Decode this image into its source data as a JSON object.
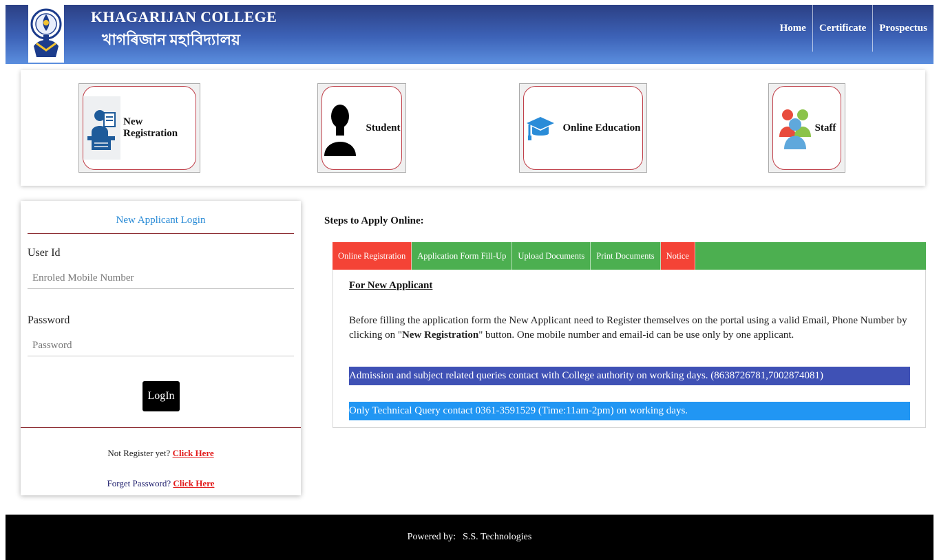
{
  "header": {
    "college_name_en": "KHAGARIJAN COLLEGE",
    "college_name_bn": "খাগৰিজান মহাবিদ্যালয়",
    "nav": [
      "Home",
      "Certificate",
      "Prospectus"
    ]
  },
  "tiles": [
    {
      "label": "New Registration",
      "icon": "registration-desk-icon"
    },
    {
      "label": "Student",
      "icon": "person-silhouette-icon"
    },
    {
      "label": "Online Education",
      "icon": "graduation-cap-icon"
    },
    {
      "label": "Staff",
      "icon": "group-people-icon"
    }
  ],
  "login": {
    "title": "New Applicant Login",
    "user_id_label": "User Id",
    "user_id_placeholder": "Enroled Mobile Number",
    "password_label": "Password",
    "password_placeholder": "Password",
    "button": "LogIn",
    "not_register_text": "Not Register yet? ",
    "not_register_link": "Click Here",
    "forget_text": "Forget Password? ",
    "forget_link": "Click Here"
  },
  "steps": {
    "title": "Steps to Apply Online:",
    "tabs": [
      "Online Registration",
      "Application Form Fill-Up",
      "Upload Documents",
      "Print Documents",
      "Notice"
    ],
    "heading": "For New Applicant",
    "para_before": "Before filling the application form the New Applicant need to Register themselves on the portal using a valid Email, Phone Number by clicking on \"",
    "para_bold": "New Registration",
    "para_after": "\" button. One mobile number and email-id can be use only by one applicant.",
    "notice_1": "Admission and subject related queries contact with College authority on working days. (8638726781,7002874081)",
    "notice_2": "Only Technical Query contact 0361-3591529 (Time:11am-2pm) on working days."
  },
  "footer": {
    "powered_label": "Powered by:",
    "company": "S.S. Technologies"
  },
  "colors": {
    "header_gradient_top": "#2b3f84",
    "header_gradient_bottom": "#5b8ede",
    "tab_red": "#f44336",
    "tab_green": "#4caf50",
    "notice_1_bg": "#3f51b5",
    "notice_2_bg": "#2196f3",
    "link_red": "#e21b1b",
    "login_title": "#2a8bd6"
  }
}
